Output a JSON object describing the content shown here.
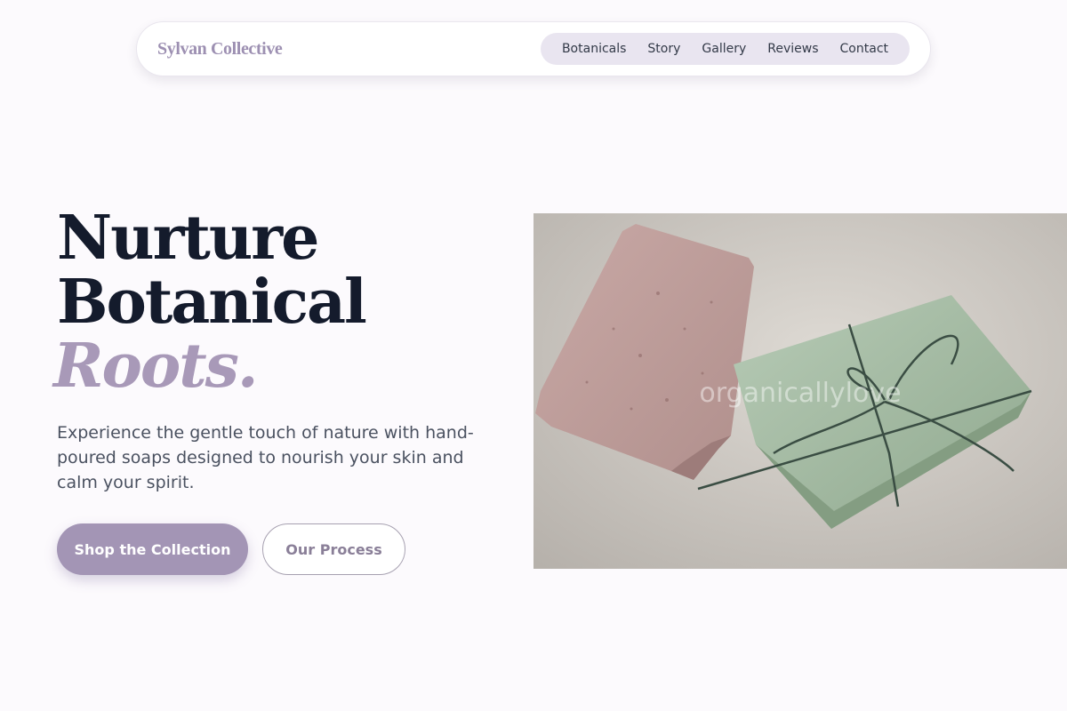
{
  "nav": {
    "brand": "Sylvan Collective",
    "links": [
      "Botanicals",
      "Story",
      "Gallery",
      "Reviews",
      "Contact"
    ]
  },
  "hero": {
    "title_line1": "Nurture",
    "title_line2": "Botanical",
    "title_accent": "Roots.",
    "description": "Experience the gentle touch of nature with hand-poured soaps designed to nourish your skin and calm your spirit.",
    "primary_button": "Shop the Collection",
    "secondary_button": "Our Process",
    "image_watermark": "organicallylove"
  },
  "colors": {
    "page_bg": "#fcfafd",
    "accent_lavender": "#a395b5",
    "title_dark": "#141b2c",
    "nav_pill": "#e9e5f0"
  }
}
